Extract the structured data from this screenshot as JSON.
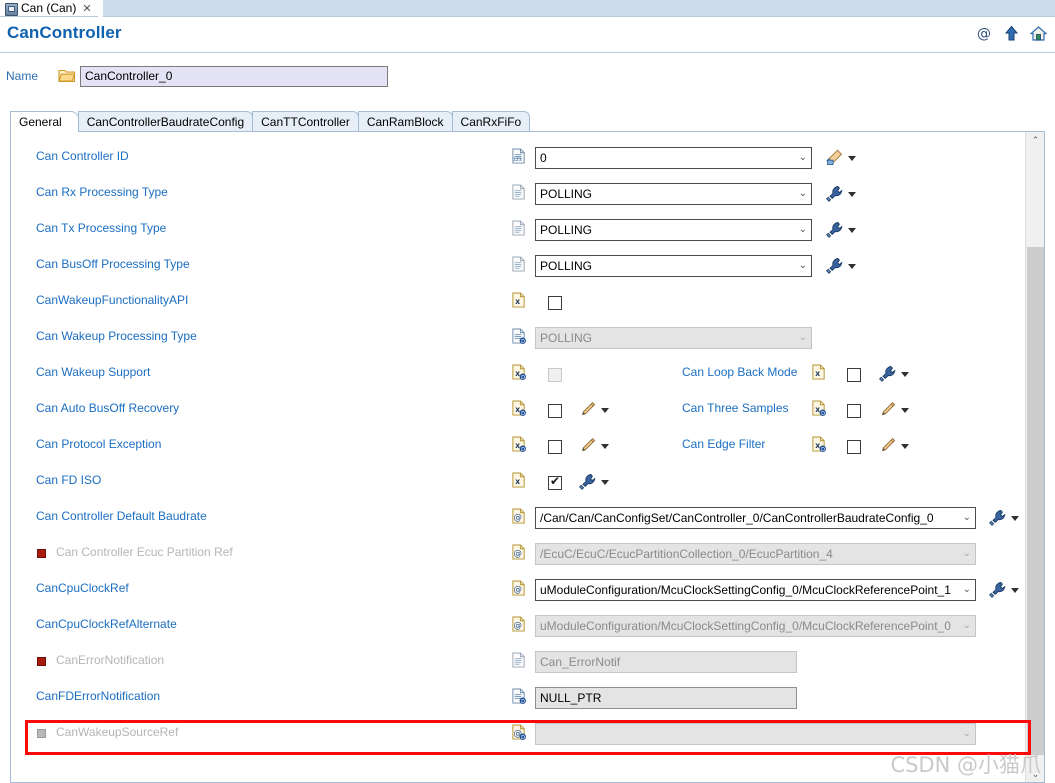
{
  "editor_tab": {
    "label": "Can (Can)",
    "close": "✕",
    "icon": "can-module-icon"
  },
  "header": {
    "title": "CanController",
    "icons": [
      {
        "name": "at-link-icon",
        "glyph": "@"
      },
      {
        "name": "up-arrow-icon",
        "glyph": "⇧"
      },
      {
        "name": "home-icon",
        "glyph": "⌂"
      }
    ]
  },
  "name_row": {
    "label": "Name",
    "value": "CanController_0",
    "folder_icon": "open-folder-icon"
  },
  "tabs": [
    {
      "label": "General",
      "active": true
    },
    {
      "label": "CanControllerBaudrateConfig",
      "active": false
    },
    {
      "label": "CanTTController",
      "active": false
    },
    {
      "label": "CanRamBlock",
      "active": false
    },
    {
      "label": "CanRxFiFo",
      "active": false
    }
  ],
  "rows": [
    {
      "label": "Can Controller ID",
      "type_icon": "numeric-param-icon",
      "control": "combo",
      "value": "0",
      "enabled": true,
      "action": "wand"
    },
    {
      "label": "Can Rx Processing Type",
      "type_icon": "enum-param-icon",
      "control": "combo",
      "value": "POLLING",
      "enabled": true,
      "action": "plug"
    },
    {
      "label": "Can Tx Processing Type",
      "type_icon": "enum-param-icon",
      "control": "combo",
      "value": "POLLING",
      "enabled": true,
      "action": "plug"
    },
    {
      "label": "Can BusOff Processing Type",
      "type_icon": "enum-param-icon",
      "control": "combo",
      "value": "POLLING",
      "enabled": true,
      "action": "plug"
    },
    {
      "label": "CanWakeupFunctionalityAPI",
      "type_icon": "boolean-param-icon",
      "control": "checkbox",
      "checked": false,
      "enabled": true,
      "action": "none"
    },
    {
      "label": "Can Wakeup Processing Type",
      "type_icon": "enum-derived-icon",
      "control": "combo",
      "value": "POLLING",
      "enabled": false,
      "action": "none"
    },
    {
      "label": "Can Wakeup Support",
      "type_icon": "boolean-derived-icon",
      "control": "checkbox",
      "checked": false,
      "enabled": false,
      "action": "none",
      "second": {
        "label": "Can Loop Back Mode",
        "type_icon": "boolean-param-icon",
        "checked": false,
        "action": "plug"
      }
    },
    {
      "label": "Can Auto BusOff Recovery",
      "type_icon": "boolean-derived-icon",
      "control": "checkbox",
      "checked": false,
      "enabled": true,
      "action": "pencil",
      "second": {
        "label": "Can Three Samples",
        "type_icon": "boolean-derived-icon",
        "checked": false,
        "action": "pencil"
      }
    },
    {
      "label": "Can Protocol Exception",
      "type_icon": "boolean-derived-icon",
      "control": "checkbox",
      "checked": false,
      "enabled": true,
      "action": "pencil",
      "second": {
        "label": "Can Edge Filter",
        "type_icon": "boolean-derived-icon",
        "checked": false,
        "action": "pencil"
      }
    },
    {
      "label": "Can FD ISO",
      "type_icon": "boolean-param-icon",
      "control": "checkbox",
      "checked": true,
      "enabled": true,
      "action": "plug"
    },
    {
      "label": "Can Controller Default Baudrate",
      "type_icon": "reference-icon",
      "control": "combo-wide",
      "value": "/Can/Can/CanConfigSet/CanController_0/CanControllerBaudrateConfig_0",
      "enabled": true,
      "action": "plug"
    },
    {
      "label": "Can Controller Ecuc Partition Ref",
      "type_icon": "reference-icon",
      "control": "combo-wide",
      "value": "/EcuC/EcuC/EcucPartitionCollection_0/EcucPartition_4",
      "enabled": false,
      "action": "none",
      "dim": true,
      "marker": "red"
    },
    {
      "label": "CanCpuClockRef",
      "type_icon": "reference-icon",
      "control": "combo-wide",
      "value": "uModuleConfiguration/McuClockSettingConfig_0/McuClockReferencePoint_1",
      "enabled": true,
      "action": "plug",
      "highlight": true
    },
    {
      "label": "CanCpuClockRefAlternate",
      "type_icon": "reference-icon",
      "control": "combo-wide",
      "value": "uModuleConfiguration/McuClockSettingConfig_0/McuClockReferencePoint_0",
      "enabled": false,
      "action": "none"
    },
    {
      "label": "CanErrorNotification",
      "type_icon": "enum-param-icon",
      "control": "textbox",
      "value": "Can_ErrorNotif",
      "enabled": false,
      "action": "none",
      "dim": true,
      "marker": "red"
    },
    {
      "label": "CanFDErrorNotification",
      "type_icon": "enum-derived-icon",
      "control": "textbox",
      "value": "NULL_PTR",
      "enabled": true,
      "action": "none"
    },
    {
      "label": "CanWakeupSourceRef",
      "type_icon": "reference-derived-icon",
      "control": "combo-wide",
      "value": "",
      "enabled": false,
      "action": "none",
      "dim": true,
      "marker": "grey"
    }
  ],
  "scrollbar": {
    "up_glyph": "⌃",
    "down_glyph": "⌄"
  },
  "watermark": "CSDN @小猫爪"
}
